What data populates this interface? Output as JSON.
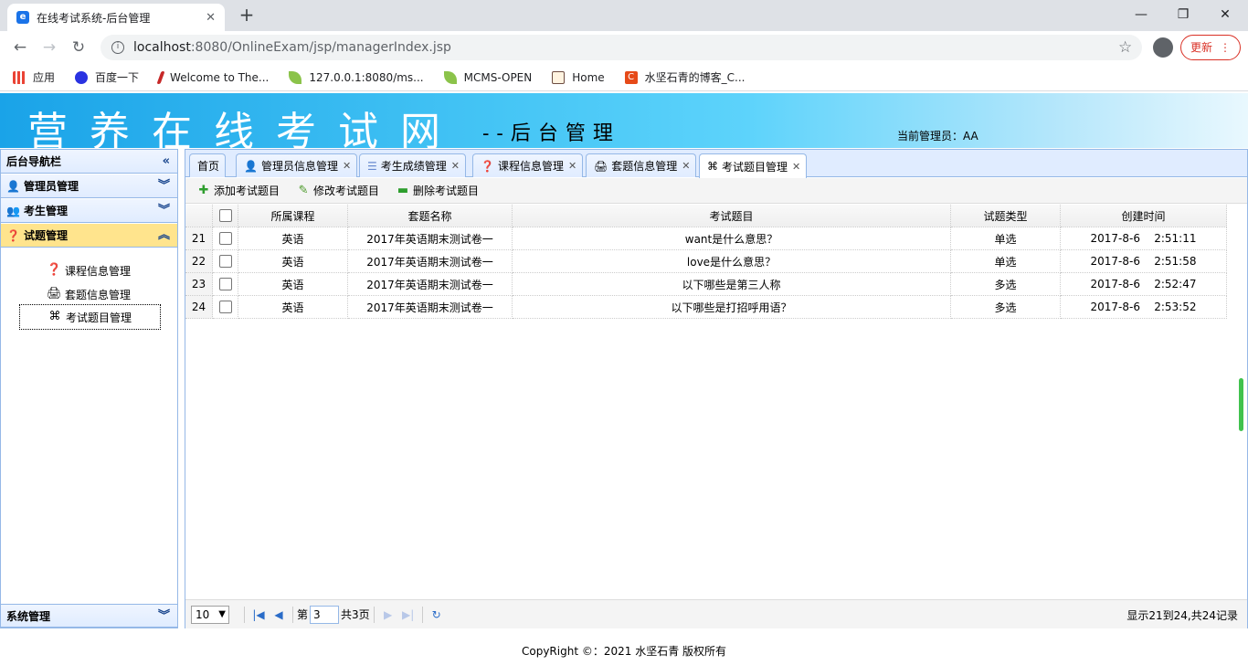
{
  "browser": {
    "tab_title": "在线考试系统-后台管理",
    "url_host": "localhost",
    "url_rest": ":8080/OnlineExam/jsp/managerIndex.jsp",
    "update_label": "更新",
    "bookmarks": [
      {
        "label": "应用",
        "color": "#ea4335"
      },
      {
        "label": "百度一下",
        "color": "#2932e1"
      },
      {
        "label": "Welcome to The...",
        "color": "#c62828"
      },
      {
        "label": "127.0.0.1:8080/ms...",
        "color": "#8bc34a"
      },
      {
        "label": "MCMS-OPEN",
        "color": "#8bc34a"
      },
      {
        "label": "Home",
        "color": "#6d4c41"
      },
      {
        "label": "水坚石青的博客_C...",
        "color": "#e64a19"
      }
    ]
  },
  "header": {
    "title": "营养在线考试网",
    "subtitle": "--后台管理",
    "admin": "当前管理员：AA"
  },
  "sidebar": {
    "title": "后台导航栏",
    "groups": [
      {
        "label": "管理员管理"
      },
      {
        "label": "考生管理"
      },
      {
        "label": "试题管理"
      }
    ],
    "items": [
      {
        "label": "课程信息管理"
      },
      {
        "label": "套题信息管理"
      },
      {
        "label": "考试题目管理"
      }
    ],
    "system": "系统管理"
  },
  "tabs": [
    {
      "label": "首页"
    },
    {
      "label": "管理员信息管理"
    },
    {
      "label": "考生成绩管理"
    },
    {
      "label": "课程信息管理"
    },
    {
      "label": "套题信息管理"
    },
    {
      "label": "考试题目管理"
    }
  ],
  "toolbar": {
    "add": "添加考试题目",
    "edit": "修改考试题目",
    "delete": "删除考试题目"
  },
  "grid": {
    "columns": [
      "所属课程",
      "套题名称",
      "考试题目",
      "试题类型",
      "创建时间"
    ],
    "rows": [
      {
        "no": "21",
        "course": "英语",
        "set": "2017年英语期末测试卷一",
        "question": "want是什么意思？",
        "type": "单选",
        "time": "2017-8-6    2:51:11"
      },
      {
        "no": "22",
        "course": "英语",
        "set": "2017年英语期末测试卷一",
        "question": "love是什么意思？",
        "type": "单选",
        "time": "2017-8-6    2:51:58"
      },
      {
        "no": "23",
        "course": "英语",
        "set": "2017年英语期末测试卷一",
        "question": "以下哪些是第三人称",
        "type": "多选",
        "time": "2017-8-6    2:52:47"
      },
      {
        "no": "24",
        "course": "英语",
        "set": "2017年英语期末测试卷一",
        "question": "以下哪些是打招呼用语？",
        "type": "多选",
        "time": "2017-8-6    2:53:52"
      }
    ]
  },
  "pager": {
    "page_size": "10",
    "page_prefix": "第",
    "page_value": "3",
    "page_total": "共3页",
    "info": "显示21到24,共24记录"
  },
  "footer": "CopyRight ©：2021 水坚石青 版权所有"
}
